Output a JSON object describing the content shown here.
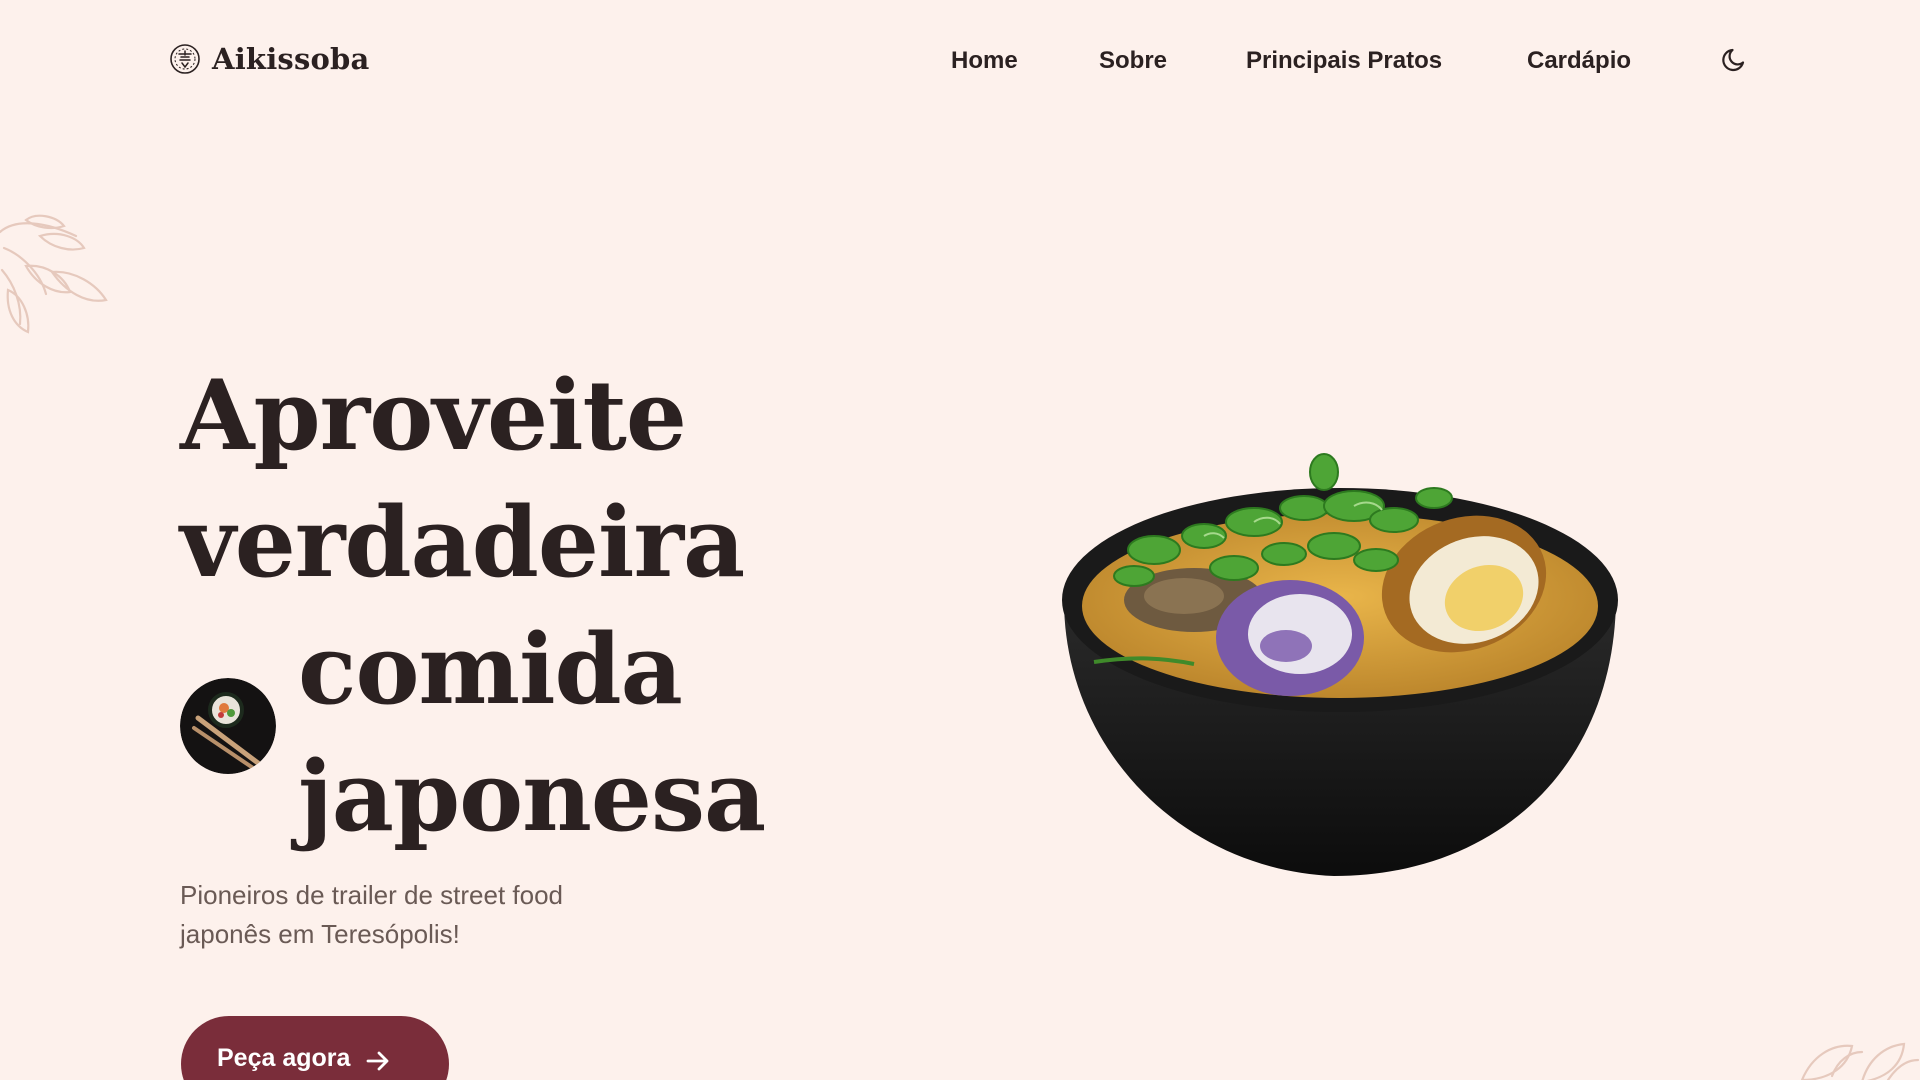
{
  "brand": {
    "name": "Aikissoba",
    "logo_icon": "sushi-emblem-icon"
  },
  "nav": {
    "items": [
      {
        "label": "Home"
      },
      {
        "label": "Sobre"
      },
      {
        "label": "Principais Pratos"
      },
      {
        "label": "Cardápio"
      }
    ],
    "theme_toggle_icon": "moon-icon"
  },
  "hero": {
    "title_lines": [
      "Aproveite",
      "verdadeira",
      "comida",
      "japonesa"
    ],
    "subtitle": "Pioneiros de trailer de street food japonês em Teresópolis!",
    "cta_label": "Peça agora",
    "cta_icon": "arrow-right-icon",
    "thumb_icon": "sushi-chopsticks-image",
    "image_icon": "ramen-bowl-image"
  },
  "colors": {
    "background": "#fdf1ec",
    "text": "#2b2121",
    "muted_text": "#6a5a55",
    "accent": "#7a2d3a",
    "decor_leaf": "#e6c9bd"
  }
}
